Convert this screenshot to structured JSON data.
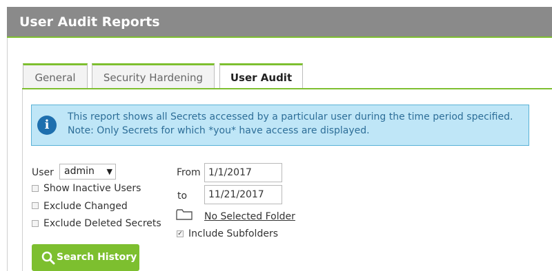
{
  "header": {
    "title": "User Audit Reports"
  },
  "tabs": [
    {
      "label": "General",
      "active": false
    },
    {
      "label": "Security Hardening",
      "active": false
    },
    {
      "label": "User Audit",
      "active": true
    }
  ],
  "info": {
    "icon": "info-icon",
    "line1": "This report shows all Secrets accessed by a particular user during the time period specified.",
    "line2": "Note: Only Secrets for which *you* have access are displayed."
  },
  "form": {
    "user_label": "User",
    "user_value": "admin",
    "show_inactive_label": "Show Inactive Users",
    "show_inactive_checked": false,
    "exclude_changed_label": "Exclude Changed",
    "exclude_changed_checked": false,
    "exclude_deleted_label": "Exclude Deleted Secrets",
    "exclude_deleted_checked": false,
    "from_label": "From",
    "from_value": "1/1/2017",
    "to_label": "to",
    "to_value": "11/21/2017",
    "folder_icon": "folder-icon",
    "folder_link": "No Selected Folder",
    "include_subfolders_label": "Include Subfolders",
    "include_subfolders_checked": true
  },
  "actions": {
    "search_label": "Search History",
    "search_icon": "search-icon"
  },
  "colors": {
    "accent": "#7dbf2f",
    "header_bg": "#8a8a8a",
    "info_bg": "#bfe6f7",
    "info_text": "#2d6e98"
  }
}
